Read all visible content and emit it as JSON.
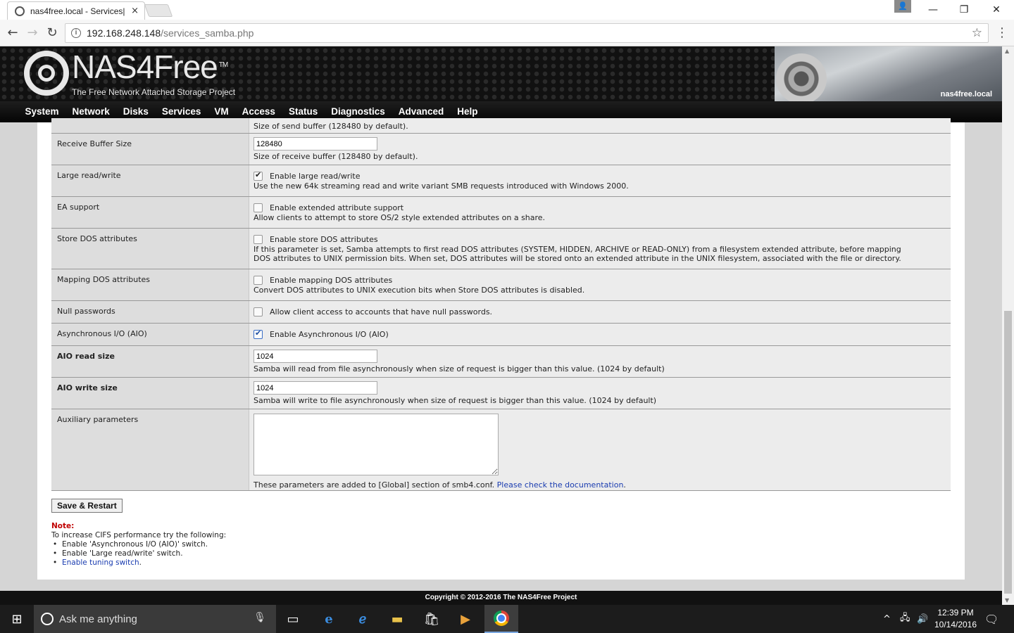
{
  "browser": {
    "tab_title": "nas4free.local - Services|",
    "tab_close": "×",
    "url_host": "192.168.248.148",
    "url_path": "/services_samba.php",
    "window_minimize": "—",
    "window_maximize": "❐",
    "window_close": "✕"
  },
  "header": {
    "logo_text": "NAS4Free",
    "logo_tm": "TM",
    "tagline": "The Free Network Attached Storage Project",
    "hostname": "nas4free.local"
  },
  "nav": [
    "System",
    "Network",
    "Disks",
    "Services",
    "VM",
    "Access",
    "Status",
    "Diagnostics",
    "Advanced",
    "Help"
  ],
  "rows": {
    "send_buffer_desc": "Size of send buffer (128480 by default).",
    "recv_buffer": {
      "label": "Receive Buffer Size",
      "value": "128480",
      "desc": "Size of receive buffer (128480 by default)."
    },
    "large_rw": {
      "label": "Large read/write",
      "checkbox": "Enable large read/write",
      "checked": true,
      "desc": "Use the new 64k streaming read and write variant SMB requests introduced with Windows 2000."
    },
    "ea_support": {
      "label": "EA support",
      "checkbox": "Enable extended attribute support",
      "checked": false,
      "desc": "Allow clients to attempt to store OS/2 style extended attributes on a share."
    },
    "store_dos": {
      "label": "Store DOS attributes",
      "checkbox": "Enable store DOS attributes",
      "checked": false,
      "desc": "If this parameter is set, Samba attempts to first read DOS attributes (SYSTEM, HIDDEN, ARCHIVE or READ-ONLY) from a filesystem extended attribute, before mapping DOS attributes to UNIX permission bits. When set, DOS attributes will be stored onto an extended attribute in the UNIX filesystem, associated with the file or directory."
    },
    "map_dos": {
      "label": "Mapping DOS attributes",
      "checkbox": "Enable mapping DOS attributes",
      "checked": false,
      "desc": "Convert DOS attributes to UNIX execution bits when Store DOS attributes is disabled."
    },
    "null_pw": {
      "label": "Null passwords",
      "checkbox": "Allow client access to accounts that have null passwords.",
      "checked": false
    },
    "aio": {
      "label": "Asynchronous I/O (AIO)",
      "checkbox": "Enable Asynchronous I/O (AIO)",
      "checked": true
    },
    "aio_read": {
      "label": "AIO read size",
      "value": "1024",
      "desc": "Samba will read from file asynchronously when size of request is bigger than this value. (1024 by default)"
    },
    "aio_write": {
      "label": "AIO write size",
      "value": "1024",
      "desc": "Samba will write to file asynchronously when size of request is bigger than this value. (1024 by default)"
    },
    "aux": {
      "label": "Auxiliary parameters",
      "value": "",
      "desc": "These parameters are added to [Global] section of smb4.conf.",
      "link": "Please check the documentation",
      "link_suffix": "."
    }
  },
  "save_button": "Save & Restart",
  "note": {
    "title": "Note:",
    "intro": "To increase CIFS performance try the following:",
    "items": [
      "Enable 'Asynchronous I/O (AIO)' switch.",
      "Enable 'Large read/write' switch."
    ],
    "link_item": "Enable tuning switch",
    "link_suffix": "."
  },
  "footer": "Copyright © 2012-2016 The NAS4Free Project",
  "taskbar": {
    "search_placeholder": "Ask me anything",
    "time": "12:39 PM",
    "date": "10/14/2016"
  }
}
